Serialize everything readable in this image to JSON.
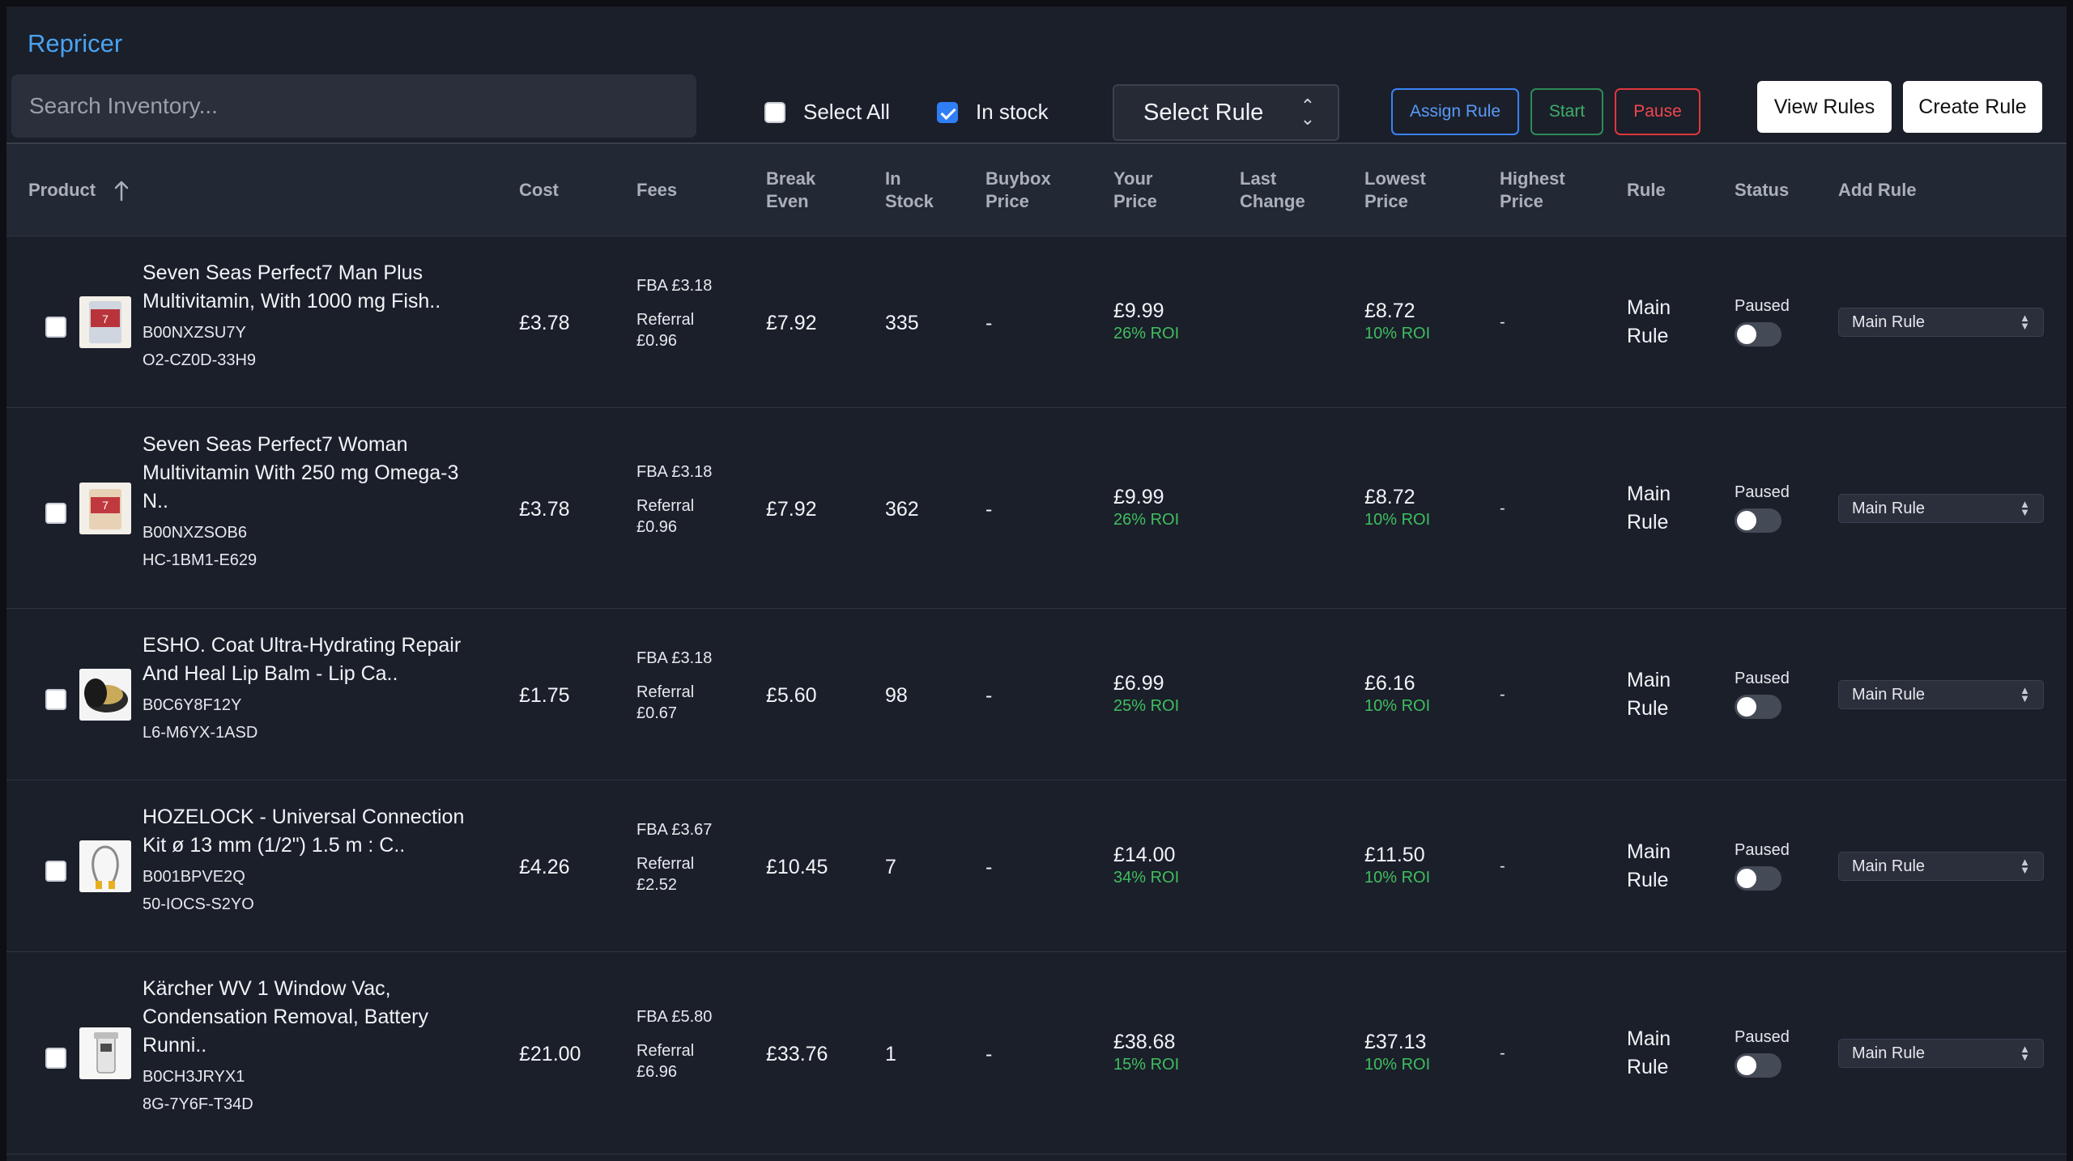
{
  "app": {
    "title": "Repricer"
  },
  "toolbar": {
    "search_placeholder": "Search Inventory...",
    "select_all_label": "Select All",
    "select_all_checked": false,
    "in_stock_label": "In stock",
    "in_stock_checked": true,
    "select_rule_label": "Select Rule",
    "assign_rule_label": "Assign Rule",
    "start_label": "Start",
    "pause_label": "Pause",
    "view_rules_label": "View Rules",
    "create_rule_label": "Create Rule"
  },
  "table": {
    "columns": {
      "product": "Product",
      "cost": "Cost",
      "fees": "Fees",
      "break_even_1": "Break",
      "break_even_2": "Even",
      "in_stock_1": "In",
      "in_stock_2": "Stock",
      "buybox_1": "Buybox",
      "buybox_2": "Price",
      "your_price_1": "Your",
      "your_price_2": "Price",
      "last_change_1": "Last",
      "last_change_2": "Change",
      "lowest_1": "Lowest",
      "lowest_2": "Price",
      "highest_1": "Highest",
      "highest_2": "Price",
      "rule": "Rule",
      "status": "Status",
      "add_rule": "Add Rule"
    },
    "sort_icon": "arrow-up-icon",
    "rows": [
      {
        "name_1": "Seven Seas Perfect7 Man Plus",
        "name_2": "Multivitamin, With 1000 mg Fish..",
        "name_3": "",
        "asin": "B00NXZSU7Y",
        "sku": "O2-CZ0D-33H9",
        "cost": "£3.78",
        "fba": "FBA £3.18",
        "referral_1": "Referral",
        "referral_2": "£0.96",
        "break_even": "£7.92",
        "in_stock": "335",
        "buybox": "-",
        "your_price": "£9.99",
        "your_roi": "26% ROI",
        "last_change": "",
        "lowest_price": "£8.72",
        "lowest_roi": "10% ROI",
        "highest_price": "-",
        "rule_1": "Main",
        "rule_2": "Rule",
        "status": "Paused",
        "add_rule": "Main Rule"
      },
      {
        "name_1": "Seven Seas Perfect7 Woman",
        "name_2": "Multivitamin With 250 mg Omega-3",
        "name_3": "N..",
        "asin": "B00NXZSOB6",
        "sku": "HC-1BM1-E629",
        "cost": "£3.78",
        "fba": "FBA £3.18",
        "referral_1": "Referral",
        "referral_2": "£0.96",
        "break_even": "£7.92",
        "in_stock": "362",
        "buybox": "-",
        "your_price": "£9.99",
        "your_roi": "26% ROI",
        "last_change": "",
        "lowest_price": "£8.72",
        "lowest_roi": "10% ROI",
        "highest_price": "-",
        "rule_1": "Main",
        "rule_2": "Rule",
        "status": "Paused",
        "add_rule": "Main Rule"
      },
      {
        "name_1": "ESHO. Coat Ultra-Hydrating Repair",
        "name_2": "And Heal Lip Balm - Lip Ca..",
        "name_3": "",
        "asin": "B0C6Y8F12Y",
        "sku": "L6-M6YX-1ASD",
        "cost": "£1.75",
        "fba": "FBA £3.18",
        "referral_1": "Referral",
        "referral_2": "£0.67",
        "break_even": "£5.60",
        "in_stock": "98",
        "buybox": "-",
        "your_price": "£6.99",
        "your_roi": "25% ROI",
        "last_change": "",
        "lowest_price": "£6.16",
        "lowest_roi": "10% ROI",
        "highest_price": "-",
        "rule_1": "Main",
        "rule_2": "Rule",
        "status": "Paused",
        "add_rule": "Main Rule"
      },
      {
        "name_1": "HOZELOCK - Universal Connection",
        "name_2": "Kit ø 13 mm (1/2\") 1.5 m : C..",
        "name_3": "",
        "asin": "B001BPVE2Q",
        "sku": "50-IOCS-S2YO",
        "cost": "£4.26",
        "fba": "FBA £3.67",
        "referral_1": "Referral",
        "referral_2": "£2.52",
        "break_even": "£10.45",
        "in_stock": "7",
        "buybox": "-",
        "your_price": "£14.00",
        "your_roi": "34% ROI",
        "last_change": "",
        "lowest_price": "£11.50",
        "lowest_roi": "10% ROI",
        "highest_price": "-",
        "rule_1": "Main",
        "rule_2": "Rule",
        "status": "Paused",
        "add_rule": "Main Rule"
      },
      {
        "name_1": "Kärcher WV 1 Window Vac,",
        "name_2": "Condensation Removal, Battery",
        "name_3": "Runni..",
        "asin": "B0CH3JRYX1",
        "sku": "8G-7Y6F-T34D",
        "cost": "£21.00",
        "fba": "FBA £5.80",
        "referral_1": "Referral",
        "referral_2": "£6.96",
        "break_even": "£33.76",
        "in_stock": "1",
        "buybox": "-",
        "your_price": "£38.68",
        "your_roi": "15% ROI",
        "last_change": "",
        "lowest_price": "£37.13",
        "lowest_roi": "10% ROI",
        "highest_price": "-",
        "rule_1": "Main",
        "rule_2": "Rule",
        "status": "Paused",
        "add_rule": "Main Rule"
      }
    ]
  },
  "colors": {
    "background": "#1b1f2a",
    "accent": "#4aa3f0",
    "roi_green": "#3fbf5f",
    "assign_blue": "#3b82f6",
    "start_green": "#2e8b57",
    "pause_red": "#e0373c"
  }
}
